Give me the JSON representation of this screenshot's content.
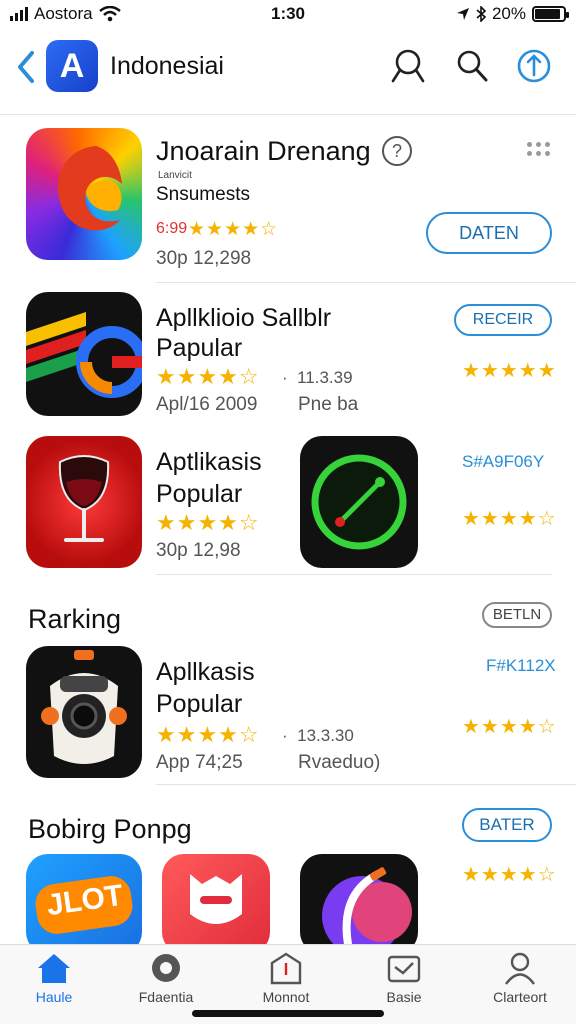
{
  "status": {
    "carrier": "Aostora",
    "time": "1:30",
    "battery": "20%",
    "battery_level": 0.9
  },
  "nav": {
    "title": "Indonesiai",
    "logo_letter": "A"
  },
  "featured": {
    "title": "Jnoarain  Drenang",
    "badge": "?",
    "tiny": "Lanvicit",
    "subtitle": "Snsumests",
    "price": "6:99",
    "stars": "★★★★☆",
    "meta": "30p 12,298",
    "button": "DATEN"
  },
  "apps": [
    {
      "title_line1": "Apllklioio Sallblr",
      "title_line2": "Papular",
      "stars": "★★★★☆",
      "size": "11.3.39",
      "meta": "Apl/16 2009",
      "meta2": "Pne ba",
      "button": "RECEIR",
      "right_stars": "★★★★★"
    },
    {
      "title_line1": "Aptlikasis",
      "title_line2": "Popular",
      "stars": "★★★★☆",
      "meta": "30p 12,98",
      "right_label": "S#A9F06Y",
      "right_stars": "★★★★☆"
    }
  ],
  "ranking": {
    "title": "Rarking",
    "button": "BETLN",
    "app": {
      "title_line1": "Apllkasis",
      "title_line2": "Popular",
      "stars": "★★★★☆",
      "size": "13.3.30",
      "meta": "App 74;25",
      "meta2": "Rvaeduo)",
      "right_label": "F#K112X",
      "right_stars": "★★★★☆"
    }
  },
  "popular": {
    "title": "Bobirg Ponpg",
    "button": "BATER",
    "icon1_text": "JLOT",
    "right_stars": "★★★★☆"
  },
  "tabs": [
    {
      "label": "Haule",
      "icon": "home-icon"
    },
    {
      "label": "Fdaentia",
      "icon": "games-icon"
    },
    {
      "label": "Monnot",
      "icon": "apps-icon"
    },
    {
      "label": "Basie",
      "icon": "arcade-icon"
    },
    {
      "label": "Clarteort",
      "icon": "account-icon"
    }
  ]
}
